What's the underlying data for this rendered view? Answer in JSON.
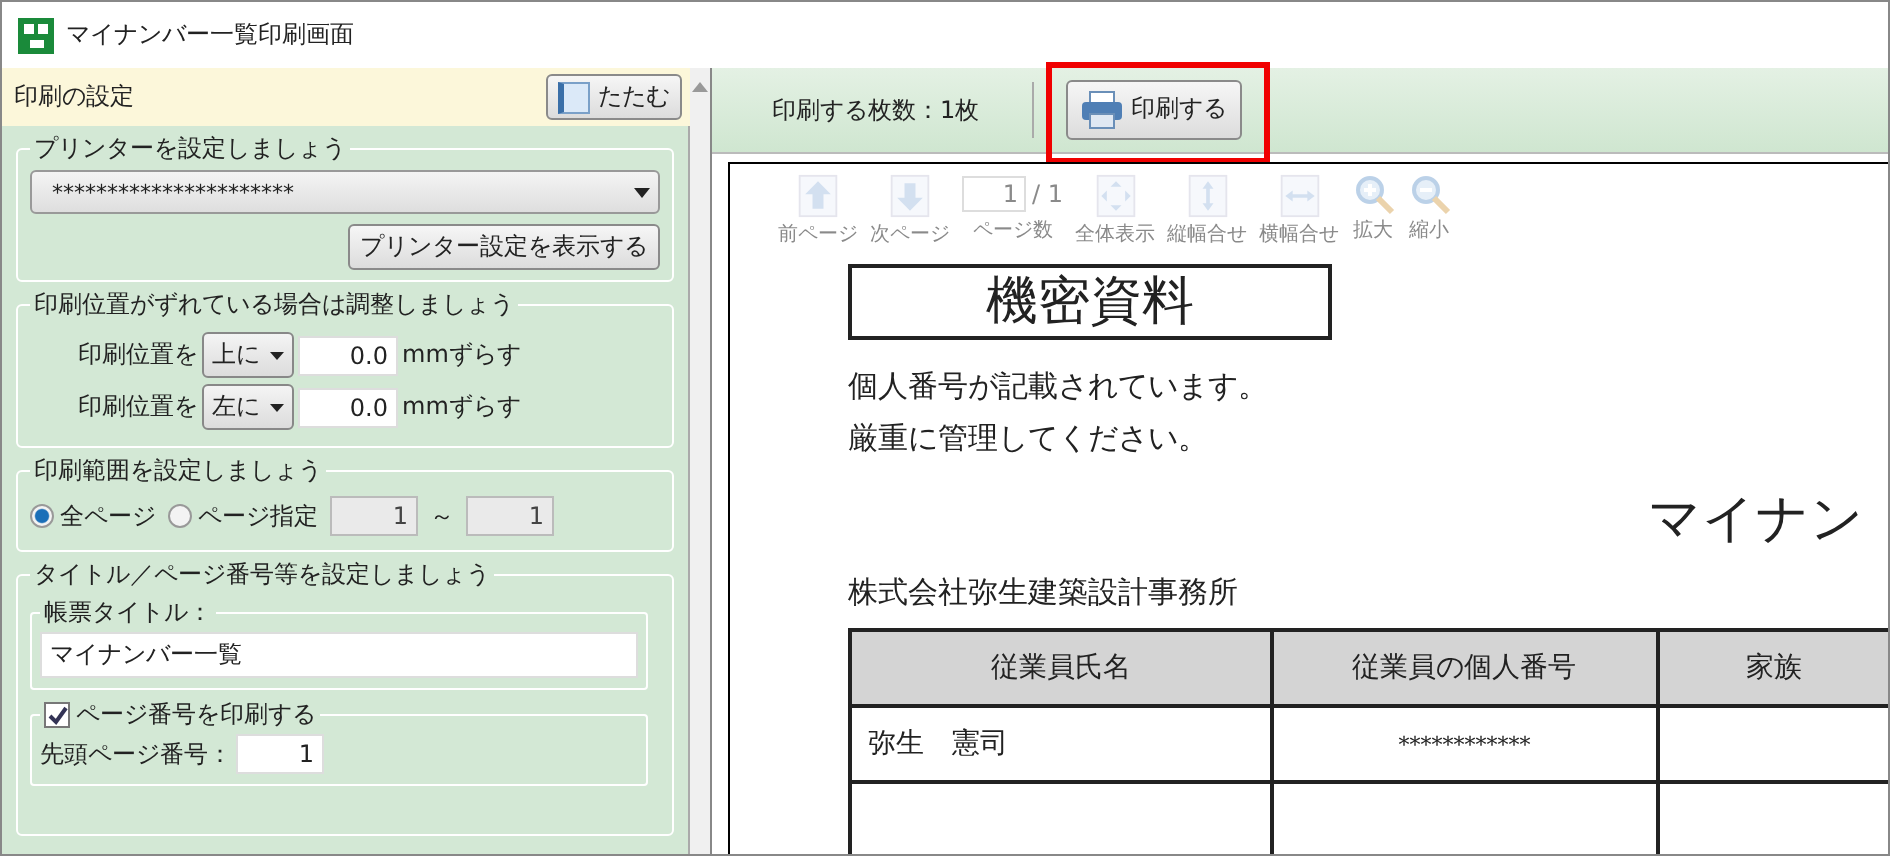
{
  "window": {
    "title": "マイナンバー一覧印刷画面"
  },
  "settings": {
    "title": "印刷の設定",
    "collapse_button": "たたむ",
    "printer_group": {
      "legend": "プリンターを設定しましょう",
      "printer": "**********************",
      "show_button": "プリンター設定を表示する"
    },
    "offset_group": {
      "legend": "印刷位置がずれている場合は調整しましょう",
      "rows": [
        {
          "label": "印刷位置を",
          "direction": "上に",
          "value": "0.0",
          "unit": "mmずらす"
        },
        {
          "label": "印刷位置を",
          "direction": "左に",
          "value": "0.0",
          "unit": "mmずらす"
        }
      ]
    },
    "range_group": {
      "legend": "印刷範囲を設定しましょう",
      "options": [
        {
          "label": "全ページ",
          "selected": true
        },
        {
          "label": "ページ指定",
          "selected": false
        }
      ],
      "from": "1",
      "separator": "～",
      "to": "1"
    },
    "title_group": {
      "legend": "タイトル／ページ番号等を設定しましょう",
      "report_title_label": "帳票タイトル：",
      "report_title": "マイナンバー一覧",
      "page_number": {
        "label": "ページ番号を印刷する",
        "checked": true
      },
      "start_page_label": "先頭ページ番号：",
      "start_page": "1"
    }
  },
  "toolbar": {
    "copies": "印刷する枚数：1枚",
    "print_button": {
      "label": "印刷する",
      "highlighted": true
    }
  },
  "preview_tools": [
    {
      "kind": "prev",
      "label": "前ページ",
      "disabled": true
    },
    {
      "kind": "next",
      "label": "次ページ",
      "disabled": true
    },
    {
      "kind": "page",
      "value": "1",
      "total": "/ 1",
      "label": "ページ数",
      "disabled": true
    },
    {
      "kind": "fit_all",
      "label": "全体表示",
      "disabled": true
    },
    {
      "kind": "fit_height",
      "label": "縦幅合せ",
      "disabled": true
    },
    {
      "kind": "fit_width",
      "label": "横幅合せ",
      "disabled": true
    },
    {
      "kind": "zoom_in",
      "label": "拡大",
      "disabled": true
    },
    {
      "kind": "zoom_out",
      "label": "縮小",
      "disabled": true
    }
  ],
  "document": {
    "stamp": "機密資料",
    "notice": [
      "個人番号が記載されています。",
      "厳重に管理してください。"
    ],
    "heading": "マイナン",
    "company": "株式会社弥生建築設計事務所",
    "table": {
      "columns": [
        "従業員氏名",
        "従業員の個人番号",
        "家族"
      ],
      "rows": [
        [
          "弥生　憲司",
          "************"
        ]
      ]
    }
  }
}
